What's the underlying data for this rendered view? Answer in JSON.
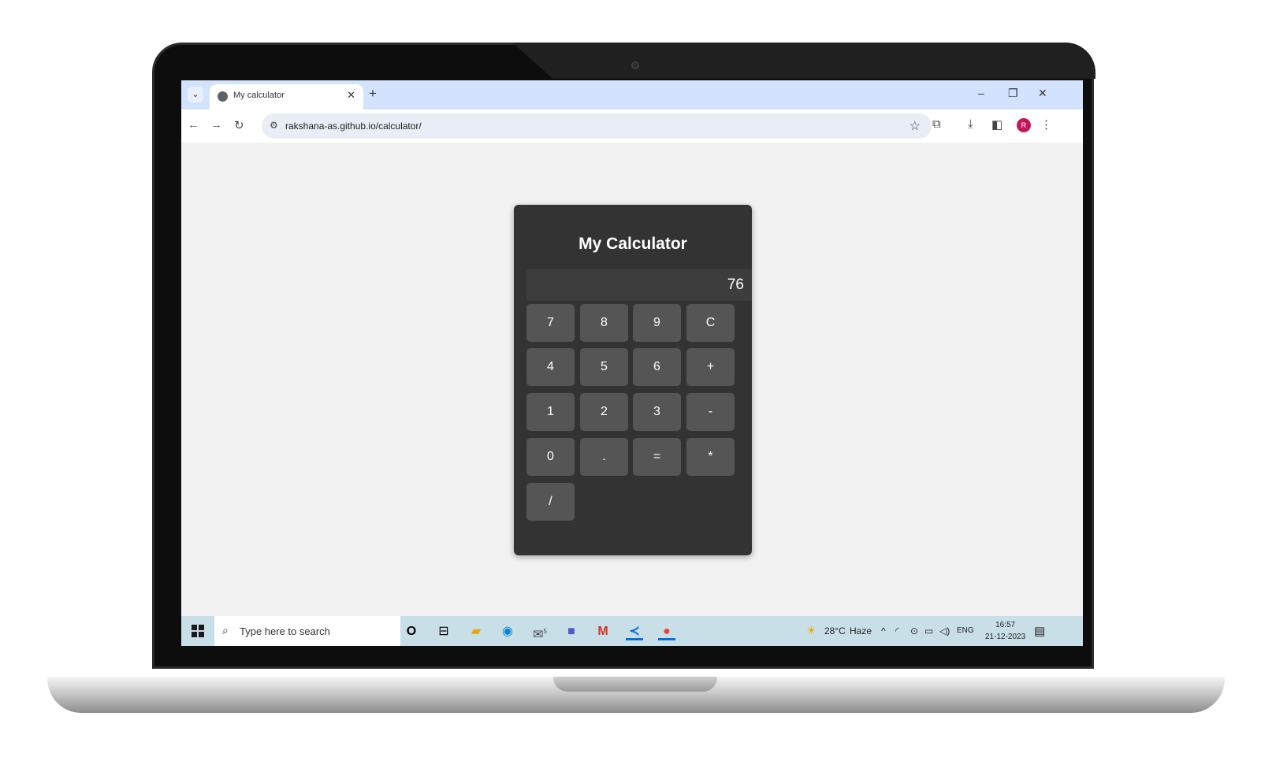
{
  "browser": {
    "tab_title": "My calculator",
    "tab_close": "✕",
    "new_tab": "+",
    "url": "rakshana-as.github.io/calculator/",
    "profile_initial": "R",
    "window_controls": {
      "minimize": "–",
      "restore": "❐",
      "close": "✕"
    }
  },
  "calculator": {
    "title": "My Calculator",
    "display": "76",
    "keys": [
      "7",
      "8",
      "9",
      "C",
      "4",
      "5",
      "6",
      "+",
      "1",
      "2",
      "3",
      "-",
      "0",
      ".",
      "=",
      "*",
      "/"
    ]
  },
  "taskbar": {
    "search_placeholder": "Type here to search",
    "weather_temp": "28°C",
    "weather_desc": "Haze",
    "language": "ENG",
    "time": "16:57",
    "date": "21-12-2023",
    "mail_badge": "5"
  },
  "colors": {
    "calc_body": "#333333",
    "calc_key": "#555555",
    "page_bg": "#f2f2f2",
    "tabbar": "#d3e3fd",
    "taskbar": "#c9dfe8"
  }
}
